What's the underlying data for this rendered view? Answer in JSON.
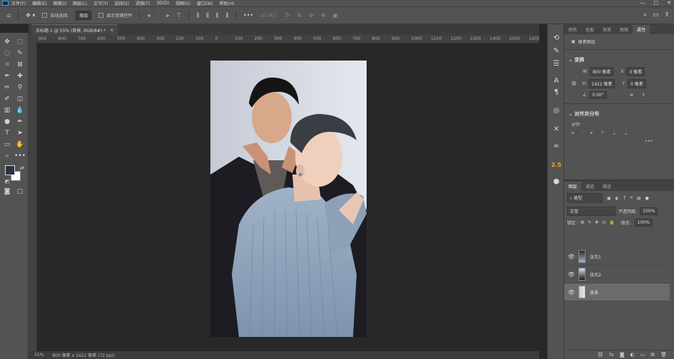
{
  "menu": [
    "文件(F)",
    "编辑(E)",
    "图像(I)",
    "图层(L)",
    "文字(Y)",
    "选择(S)",
    "滤镜(T)",
    "3D(D)",
    "视图(V)",
    "窗口(W)",
    "帮助(H)"
  ],
  "window_controls": [
    "—",
    "□",
    "✕"
  ],
  "options": {
    "auto_select_label": "自动选择:",
    "auto_select_value": "图层",
    "show_transform_label": "显示变换控件",
    "mode_3d_label": "3D 模式:"
  },
  "document_tab": {
    "title": "未标题-1 @ 55% (背景, RGB/8#) *",
    "close": "×"
  },
  "ruler_ticks": [
    "900",
    "800",
    "700",
    "600",
    "500",
    "400",
    "300",
    "200",
    "100",
    "0",
    "100",
    "200",
    "300",
    "400",
    "500",
    "600",
    "700",
    "800",
    "900",
    "1000",
    "1100",
    "1200",
    "1300",
    "1400",
    "1500",
    "1600"
  ],
  "status": {
    "zoom": "55%",
    "doc_size": "800 像素 x 1422 像素 (72 ppi)"
  },
  "panel_tabs_top": [
    "颜色",
    "色板",
    "渐变",
    "图案",
    "属性"
  ],
  "properties": {
    "header": "像素图层",
    "transform_title": "变换",
    "w_label": "W",
    "w_value": "800 像素",
    "x_label": "X",
    "x_value": "0 像素",
    "h_label": "H",
    "h_value": "1422 像素",
    "y_label": "Y",
    "y_value": "0 像素",
    "angle_value": "0.00°",
    "align_title": "对齐并分布",
    "align_label": "对齐:",
    "more": "•••"
  },
  "layers_panel": {
    "tabs": [
      "图层",
      "通道",
      "路径"
    ],
    "filter_label": "类型",
    "blend_mode": "正常",
    "opacity_label": "不透明度:",
    "opacity_value": "100%",
    "lock_label": "锁定:",
    "fill_label": "填充:",
    "fill_value": "100%",
    "layers": [
      {
        "name": "张杰1",
        "selected": false
      },
      {
        "name": "张杰2",
        "selected": false
      },
      {
        "name": "背景",
        "selected": true
      }
    ]
  },
  "strip_badge": "2.5",
  "colors": {
    "foreground": "#2b3342",
    "background": "#ffffff",
    "accent": "#31a8ff"
  }
}
